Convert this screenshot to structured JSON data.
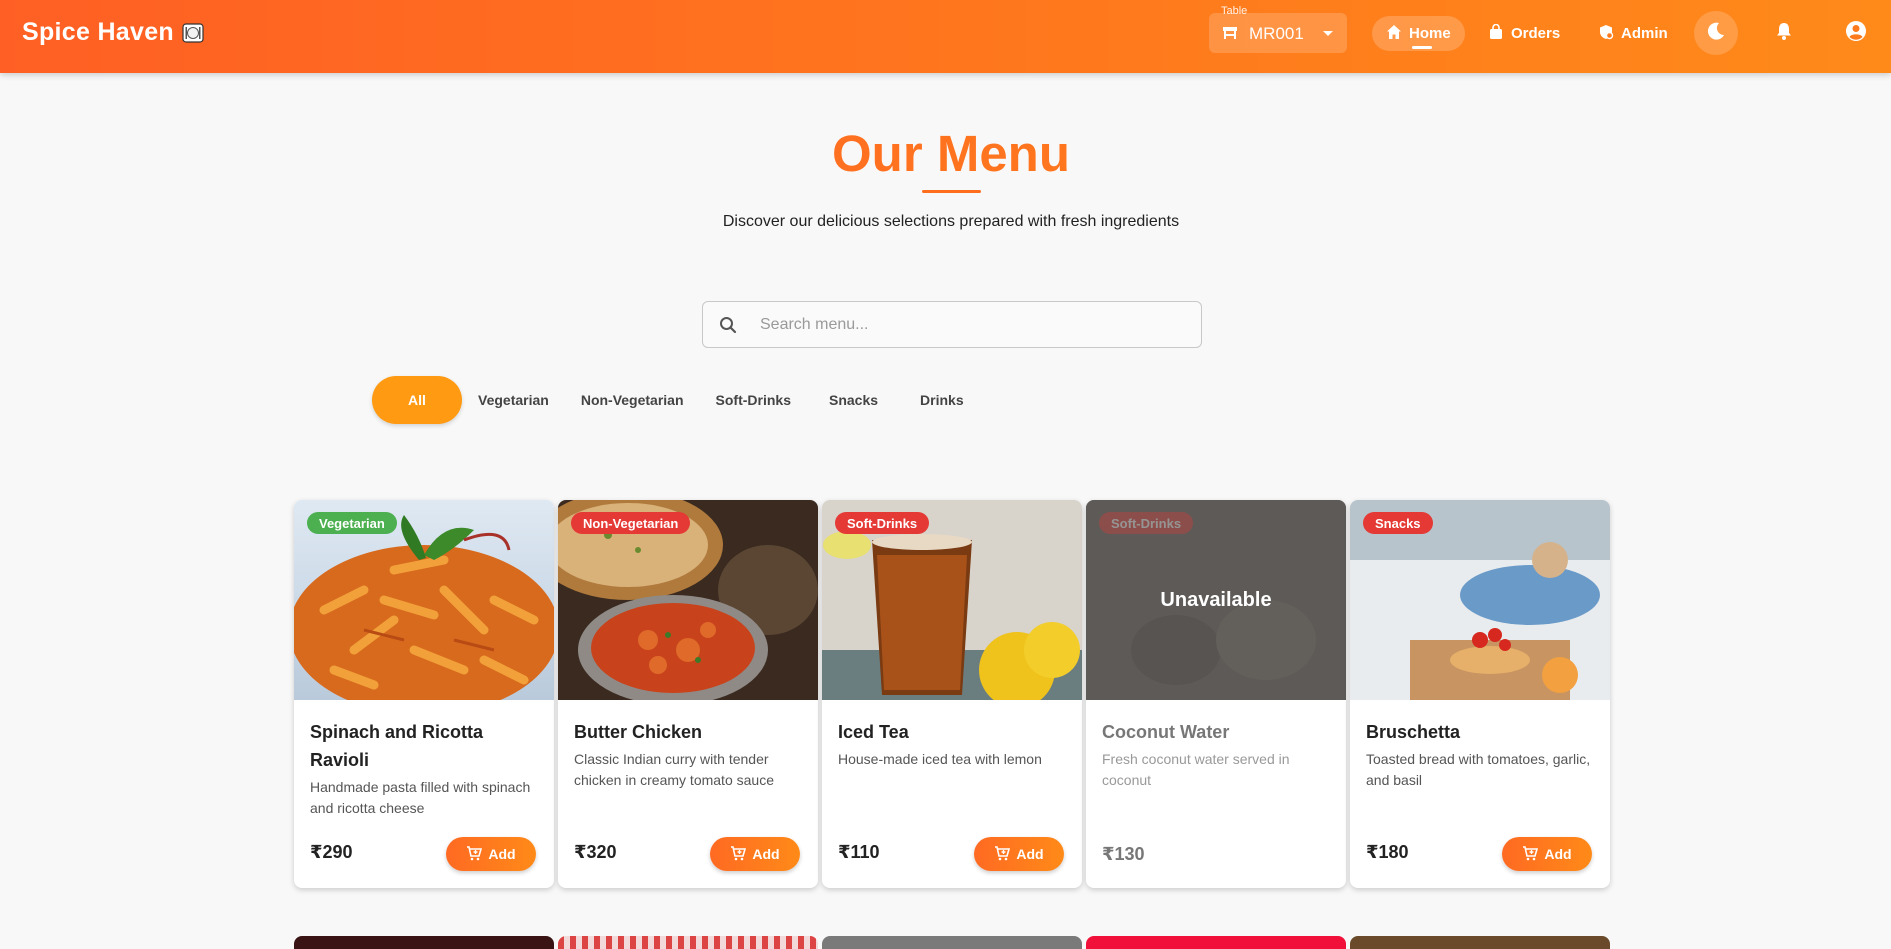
{
  "header": {
    "brand": "Spice Haven",
    "brand_icon": "plate-cutlery-icon",
    "table_label": "Table",
    "table_value": "MR001",
    "nav": [
      {
        "label": "Home",
        "icon": "home-icon"
      },
      {
        "label": "Orders",
        "icon": "bag-icon"
      },
      {
        "label": "Admin",
        "icon": "admin-shield-icon"
      }
    ]
  },
  "hero": {
    "title": "Our Menu",
    "subtitle": "Discover our delicious selections prepared with fresh ingredients"
  },
  "search": {
    "placeholder": "Search menu..."
  },
  "filters": [
    "All",
    "Vegetarian",
    "Non-Vegetarian",
    "Soft-Drinks",
    "Snacks",
    "Drinks"
  ],
  "active_filter": "All",
  "add_label": "Add",
  "unavailable_label": "Unavailable",
  "items": [
    {
      "name": "Spinach and Ricotta Ravioli",
      "category": "Vegetarian",
      "description": "Handmade pasta filled with spinach and ricotta cheese",
      "price": "₹290",
      "available": true
    },
    {
      "name": "Butter Chicken",
      "category": "Non-Vegetarian",
      "description": "Classic Indian curry with tender chicken in creamy tomato sauce",
      "price": "₹320",
      "available": true
    },
    {
      "name": "Iced Tea",
      "category": "Soft-Drinks",
      "description": "House-made iced tea with lemon",
      "price": "₹110",
      "available": true
    },
    {
      "name": "Coconut Water",
      "category": "Soft-Drinks",
      "description": "Fresh coconut water served in coconut",
      "price": "₹130",
      "available": false
    },
    {
      "name": "Bruschetta",
      "category": "Snacks",
      "description": "Toasted bread with tomatoes, garlic, and basil",
      "price": "₹180",
      "available": true
    }
  ],
  "colors": {
    "header_start": "#ff5f24",
    "header_end": "#ff8a1a",
    "accent": "#ff9a12",
    "veg_badge": "#4caf50",
    "category_badge": "#e53935"
  }
}
